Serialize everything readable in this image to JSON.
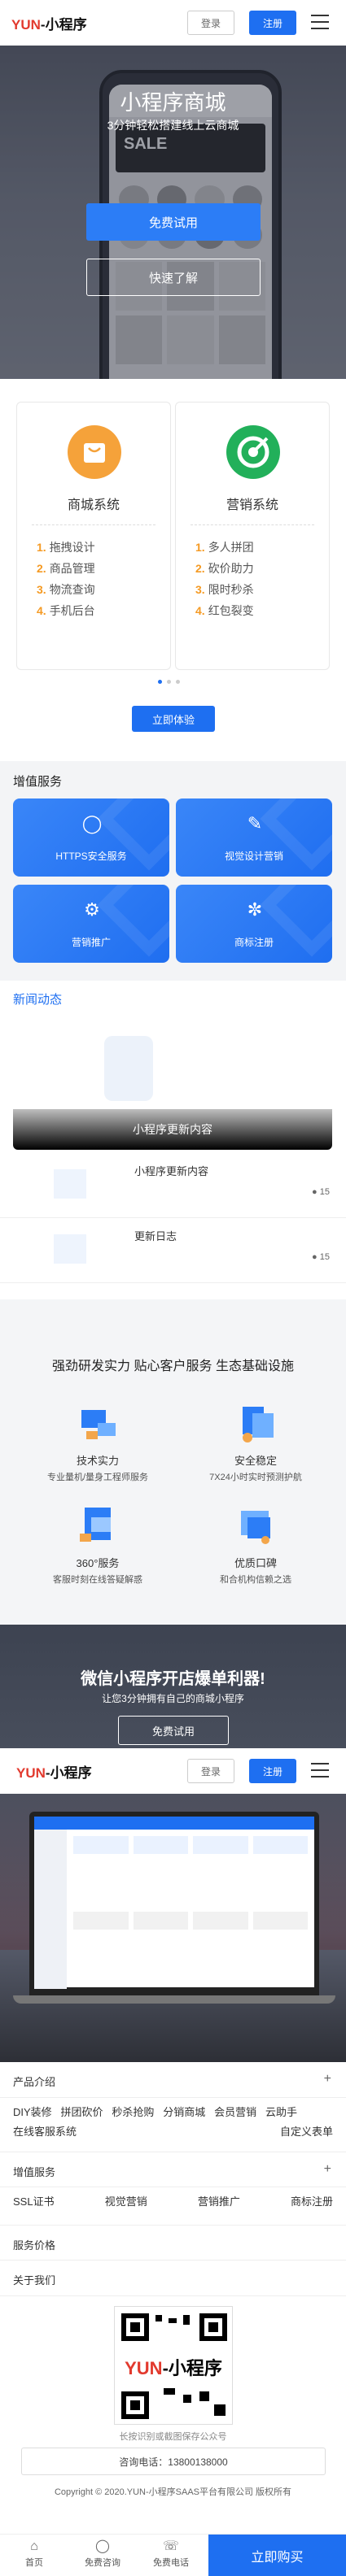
{
  "header": {
    "logo_red": "YUN",
    "logo_rest": "-小程序",
    "login": "登录",
    "register": "注册"
  },
  "hero": {
    "title": "小程序商城",
    "subtitle": "3分钟轻松搭建线上云商城",
    "try_btn": "免费试用",
    "learn_btn": "快速了解"
  },
  "systems": [
    {
      "title": "商城系统",
      "items": [
        "拖拽设计",
        "商品管理",
        "物流查询",
        "手机后台"
      ],
      "color": "#f5a23a"
    },
    {
      "title": "营销系统",
      "items": [
        "多人拼团",
        "砍价助力",
        "限时秒杀",
        "红包裂变"
      ],
      "color": "#22b05a"
    }
  ],
  "nums": [
    "1.",
    "2.",
    "3.",
    "4."
  ],
  "experience_btn": "立即体验",
  "vas": {
    "title": "增值服务",
    "items": [
      "HTTPS安全服务",
      "视觉设计营销",
      "营销推广",
      "商标注册"
    ]
  },
  "news": {
    "title": "新闻动态",
    "banner": "小程序更新内容",
    "items": [
      {
        "title": "小程序更新内容",
        "count": "15"
      },
      {
        "title": "更新日志",
        "count": "15"
      }
    ]
  },
  "features": {
    "title": "强劲研发实力  贴心客户服务  生态基础设施",
    "items": [
      {
        "head": "技术实力",
        "sub": "专业量机/量身工程师服务"
      },
      {
        "head": "安全稳定",
        "sub": "7X24小时实时预测护航"
      },
      {
        "head": "360°服务",
        "sub": "客服时刻在线答疑解惑"
      },
      {
        "head": "优质口碑",
        "sub": "和合机构信赖之选"
      }
    ]
  },
  "promo": {
    "title": "微信小程序开店爆单利器!",
    "sub": "让您3分钟拥有自己的商城小程序",
    "btn": "免费试用"
  },
  "footer": {
    "product": "产品介绍",
    "product_tags": [
      "DIY装修",
      "拼团砍价",
      "秒杀抢购",
      "分销商城",
      "会员营销",
      "云助手",
      "在线客服系统",
      "自定义表单"
    ],
    "vas": "增值服务",
    "vas_tags": [
      "SSL证书",
      "视觉营销",
      "营销推广",
      "商标注册"
    ],
    "pricing": "服务价格",
    "about": "关于我们",
    "qr_text": "长按识别或截图保存公众号",
    "qr_logo_red": "YUN",
    "qr_logo_rest": "-小程序",
    "hotline": "咨询电话：13800138000",
    "copyright": "Copyright © 2020.YUN-小程序SAAS平台有限公司 版权所有"
  },
  "bottom_bar": {
    "home": "首页",
    "consult": "免费咨询",
    "phone": "免费电话",
    "buy": "立即购买"
  }
}
